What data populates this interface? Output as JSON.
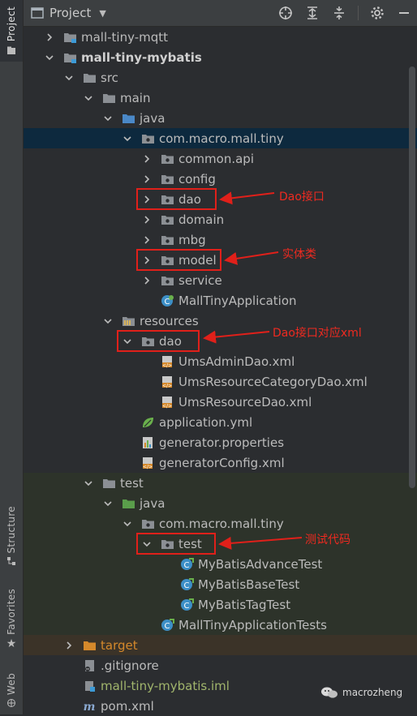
{
  "sidebar": {
    "tabs": [
      {
        "label": "Project",
        "active": true
      },
      {
        "label": "Structure"
      },
      {
        "label": "Favorites"
      },
      {
        "label": "Web"
      }
    ]
  },
  "header": {
    "title": "Project"
  },
  "tree": [
    {
      "label": "mall-tiny-mqtt",
      "depth": 1,
      "expanded": false,
      "icon": "module-folder"
    },
    {
      "label": "mall-tiny-mybatis",
      "depth": 1,
      "expanded": true,
      "icon": "module-folder",
      "bold": true
    },
    {
      "label": "src",
      "depth": 2,
      "expanded": true,
      "icon": "folder"
    },
    {
      "label": "main",
      "depth": 3,
      "expanded": true,
      "icon": "folder"
    },
    {
      "label": "java",
      "depth": 4,
      "expanded": true,
      "icon": "source-folder"
    },
    {
      "label": "com.macro.mall.tiny",
      "depth": 5,
      "expanded": true,
      "icon": "package",
      "selected": true
    },
    {
      "label": "common.api",
      "depth": 6,
      "expanded": false,
      "icon": "package"
    },
    {
      "label": "config",
      "depth": 6,
      "expanded": false,
      "icon": "package"
    },
    {
      "label": "dao",
      "depth": 6,
      "expanded": false,
      "icon": "package"
    },
    {
      "label": "domain",
      "depth": 6,
      "expanded": false,
      "icon": "package"
    },
    {
      "label": "mbg",
      "depth": 6,
      "expanded": false,
      "icon": "package"
    },
    {
      "label": "model",
      "depth": 6,
      "expanded": false,
      "icon": "package"
    },
    {
      "label": "service",
      "depth": 6,
      "expanded": false,
      "icon": "package"
    },
    {
      "label": "MallTinyApplication",
      "depth": 6,
      "icon": "spring-class"
    },
    {
      "label": "resources",
      "depth": 4,
      "expanded": true,
      "icon": "resources-folder"
    },
    {
      "label": "dao",
      "depth": 5,
      "expanded": true,
      "icon": "package"
    },
    {
      "label": "UmsAdminDao.xml",
      "depth": 6,
      "icon": "xml-file"
    },
    {
      "label": "UmsResourceCategoryDao.xml",
      "depth": 6,
      "icon": "xml-file"
    },
    {
      "label": "UmsResourceDao.xml",
      "depth": 6,
      "icon": "xml-file"
    },
    {
      "label": "application.yml",
      "depth": 5,
      "icon": "yml-file"
    },
    {
      "label": "generator.properties",
      "depth": 5,
      "icon": "properties-file"
    },
    {
      "label": "generatorConfig.xml",
      "depth": 5,
      "icon": "xml-file"
    },
    {
      "label": "test",
      "depth": 3,
      "expanded": true,
      "icon": "folder",
      "testbg": true
    },
    {
      "label": "java",
      "depth": 4,
      "expanded": true,
      "icon": "test-source-folder",
      "testbg": true
    },
    {
      "label": "com.macro.mall.tiny",
      "depth": 5,
      "expanded": true,
      "icon": "package",
      "testbg": true
    },
    {
      "label": "test",
      "depth": 6,
      "expanded": true,
      "icon": "package",
      "testbg": true
    },
    {
      "label": "MyBatisAdvanceTest",
      "depth": 7,
      "icon": "test-class",
      "testbg": true
    },
    {
      "label": "MyBatisBaseTest",
      "depth": 7,
      "icon": "test-class",
      "testbg": true
    },
    {
      "label": "MyBatisTagTest",
      "depth": 7,
      "icon": "test-class",
      "testbg": true
    },
    {
      "label": "MallTinyApplicationTests",
      "depth": 6,
      "icon": "test-class",
      "testbg": true
    },
    {
      "label": "target",
      "depth": 2,
      "expanded": false,
      "icon": "excluded-folder",
      "color": "orange",
      "excluded": true
    },
    {
      "label": ".gitignore",
      "depth": 2,
      "icon": "ignore-file"
    },
    {
      "label": "mall-tiny-mybatis.iml",
      "depth": 2,
      "icon": "iml-file",
      "color": "green"
    },
    {
      "label": "pom.xml",
      "depth": 2,
      "icon": "maven-file"
    }
  ],
  "annotations": {
    "dao_note": "Dao接口",
    "model_note": "实体类",
    "dao_xml_note": "Dao接口对应xml",
    "test_note": "测试代码"
  },
  "watermark": {
    "text": "macrozheng"
  },
  "colors": {
    "annotation": "#e0201a",
    "selection": "#0d293e",
    "folder": "#8b8f94",
    "source_folder": "#4a88c7",
    "test_folder": "#5a9e4b",
    "excluded": "#d5892b"
  }
}
